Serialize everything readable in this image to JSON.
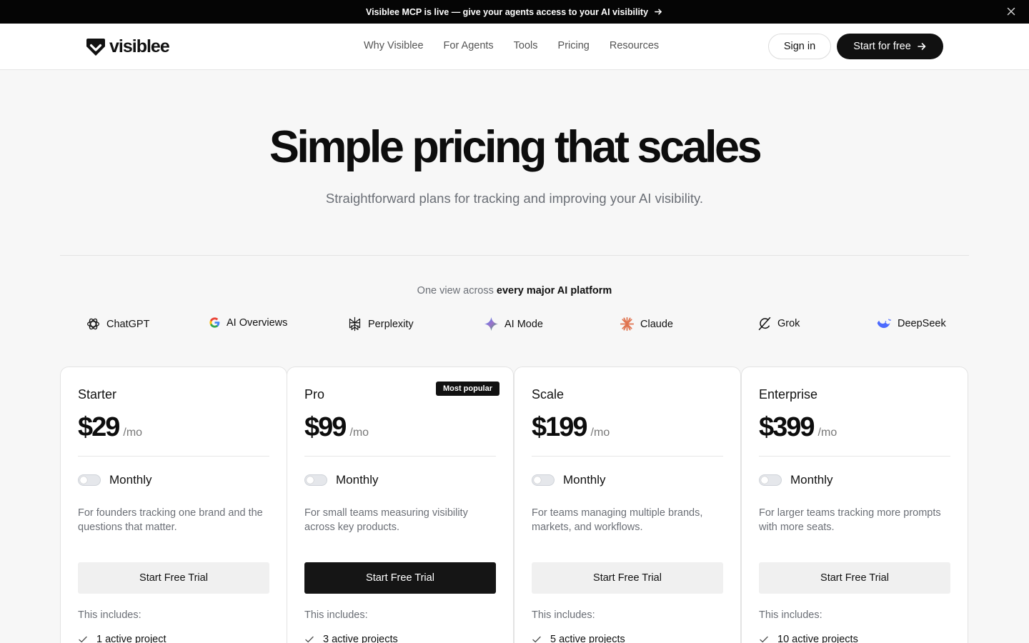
{
  "announcement": {
    "text": "Visiblee MCP is live — give your agents access to your AI visibility"
  },
  "brand": {
    "name": "visiblee"
  },
  "nav": {
    "items": [
      "Why Visiblee",
      "For Agents",
      "Tools",
      "Pricing",
      "Resources"
    ],
    "sign_in": "Sign in",
    "start_free": "Start for free"
  },
  "hero": {
    "title": "Simple pricing that scales",
    "subtitle": "Straightforward plans for tracking and improving your AI visibility."
  },
  "platforms": {
    "caption_prefix": "One view across",
    "caption_bold": "every major AI platform",
    "items": [
      {
        "label": "ChatGPT",
        "icon": "chatgpt-icon"
      },
      {
        "label": "AI Overviews",
        "icon": "google-icon"
      },
      {
        "label": "Perplexity",
        "icon": "perplexity-icon"
      },
      {
        "label": "AI Mode",
        "icon": "ai-mode-sparkle-icon"
      },
      {
        "label": "Claude",
        "icon": "claude-icon"
      },
      {
        "label": "Grok",
        "icon": "grok-icon"
      },
      {
        "label": "DeepSeek",
        "icon": "deepseek-icon"
      }
    ]
  },
  "plans": [
    {
      "name": "Starter",
      "price": "$29",
      "unit": "/mo",
      "billing": "Monthly",
      "description": "For founders tracking one brand and the questions that matter.",
      "cta": "Start Free Trial",
      "includes": "This includes:",
      "feature": "1 active project",
      "badge": ""
    },
    {
      "name": "Pro",
      "price": "$99",
      "unit": "/mo",
      "billing": "Monthly",
      "description": "For small teams measuring visibility across key products.",
      "cta": "Start Free Trial",
      "includes": "This includes:",
      "feature": "3 active projects",
      "badge": "Most popular"
    },
    {
      "name": "Scale",
      "price": "$199",
      "unit": "/mo",
      "billing": "Monthly",
      "description": "For teams managing multiple brands, markets, and workflows.",
      "cta": "Start Free Trial",
      "includes": "This includes:",
      "feature": "5 active projects",
      "badge": ""
    },
    {
      "name": "Enterprise",
      "price": "$399",
      "unit": "/mo",
      "billing": "Monthly",
      "description": "For larger teams tracking more prompts with more seats.",
      "cta": "Start Free Trial",
      "includes": "This includes:",
      "feature": "10 active projects",
      "badge": ""
    }
  ],
  "colors": {
    "accent_dark": "#111111",
    "announcement_bg": "#050505",
    "page_bg": "#f7f7f7",
    "muted_text": "#6b6f76",
    "claude_orange": "#e0734f",
    "deepseek_blue": "#4d6bfe"
  }
}
